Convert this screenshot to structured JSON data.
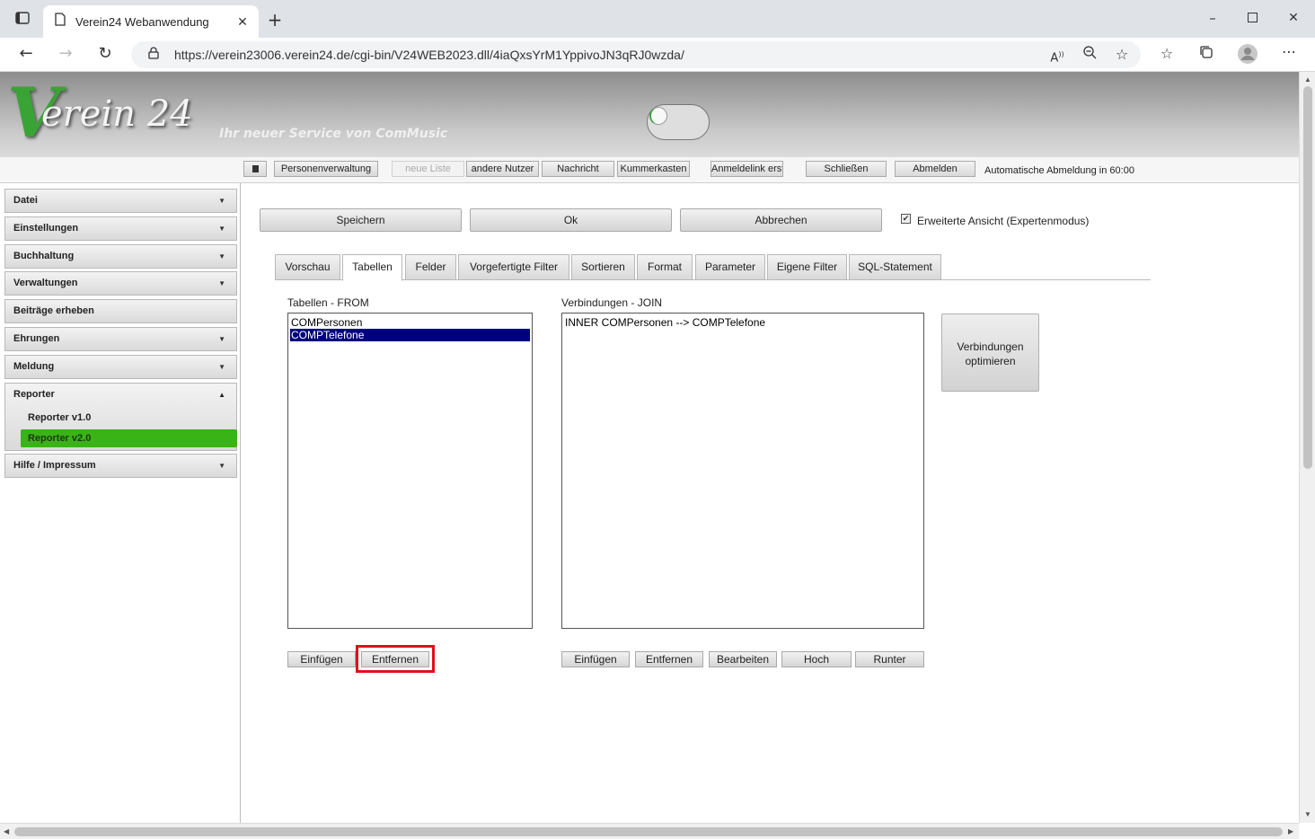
{
  "browser": {
    "tab_title": "Verein24 Webanwendung",
    "url": "https://verein23006.verein24.de/cgi-bin/V24WEB2023.dll/4iaQxsYrM1YppivoJN3qRJ0wzda/"
  },
  "header": {
    "logo_v": "V",
    "logo_rest": "erein 24",
    "slogan": "Ihr neuer Service von ComMusic"
  },
  "menubar": {
    "items": [
      "Personenverwaltung",
      "neue Liste",
      "andere Nutzer",
      "Nachricht",
      "Kummerkasten",
      "Anmeldelink erst",
      "Schließen",
      "Abmelden"
    ],
    "auto_logout": "Automatische Abmeldung in 60:00"
  },
  "sidebar": {
    "items": [
      {
        "label": "Datei"
      },
      {
        "label": "Einstellungen"
      },
      {
        "label": "Buchhaltung"
      },
      {
        "label": "Verwaltungen"
      },
      {
        "label": "Beiträge erheben"
      },
      {
        "label": "Ehrungen"
      },
      {
        "label": "Meldung"
      },
      {
        "label": "Reporter"
      },
      {
        "label": "Hilfe / Impressum"
      }
    ],
    "reporter_sub": [
      "Reporter v1.0",
      "Reporter v2.0"
    ]
  },
  "main": {
    "buttons": {
      "save": "Speichern",
      "ok": "Ok",
      "cancel": "Abbrechen"
    },
    "expert_checkbox": {
      "label": "Erweiterte Ansicht (Expertenmodus)",
      "checked": true
    },
    "tabs": [
      "Vorschau",
      "Tabellen",
      "Felder",
      "Vorgefertigte Filter",
      "Sortieren",
      "Format",
      "Parameter",
      "Eigene Filter",
      "SQL-Statement"
    ],
    "active_tab": "Tabellen",
    "tables_label": "Tabellen - FROM",
    "tables": [
      "COMPersonen",
      "COMPTelefone"
    ],
    "selected_table": "COMPTelefone",
    "joins_label": "Verbindungen - JOIN",
    "joins": [
      "INNER COMPersonen --> COMPTelefone"
    ],
    "optimize_button": "Verbindungen optimieren",
    "tables_buttons": {
      "insert": "Einfügen",
      "remove": "Entfernen"
    },
    "joins_buttons": {
      "insert": "Einfügen",
      "remove": "Entfernen",
      "edit": "Bearbeiten",
      "up": "Hoch",
      "down": "Runter"
    }
  },
  "colors": {
    "brand_green": "#3aa336",
    "active_menu": "#3ab317",
    "selection": "#00007e",
    "highlight": "#e0101a"
  }
}
